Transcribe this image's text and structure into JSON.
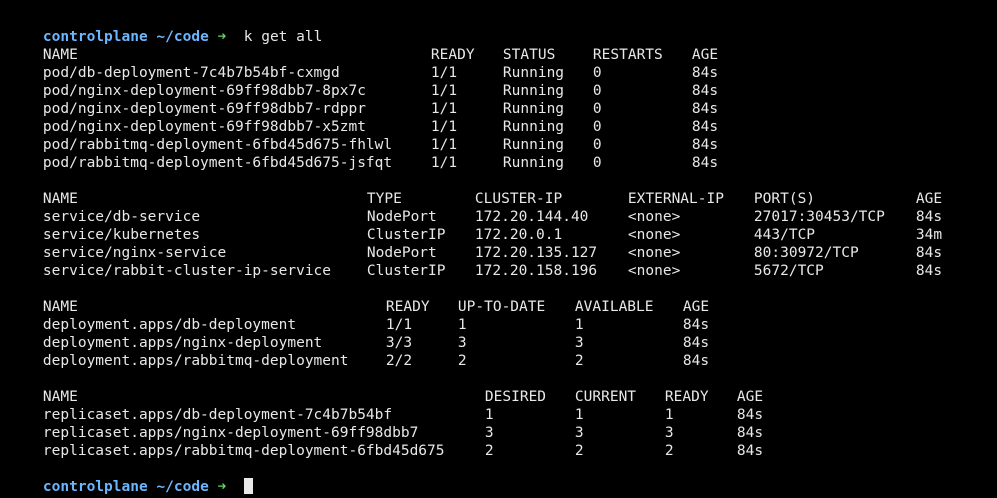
{
  "prompt": {
    "host": "controlplane",
    "cwd": "~/code",
    "arrow": "➜",
    "command": "k get all"
  },
  "pods": {
    "headers": [
      "NAME",
      "READY",
      "STATUS",
      "RESTARTS",
      "AGE"
    ],
    "rows": [
      [
        "pod/db-deployment-7c4b7b54bf-cxmgd",
        "1/1",
        "Running",
        "0",
        "84s"
      ],
      [
        "pod/nginx-deployment-69ff98dbb7-8px7c",
        "1/1",
        "Running",
        "0",
        "84s"
      ],
      [
        "pod/nginx-deployment-69ff98dbb7-rdppr",
        "1/1",
        "Running",
        "0",
        "84s"
      ],
      [
        "pod/nginx-deployment-69ff98dbb7-x5zmt",
        "1/1",
        "Running",
        "0",
        "84s"
      ],
      [
        "pod/rabbitmq-deployment-6fbd45d675-fhlwl",
        "1/1",
        "Running",
        "0",
        "84s"
      ],
      [
        "pod/rabbitmq-deployment-6fbd45d675-jsfqt",
        "1/1",
        "Running",
        "0",
        "84s"
      ]
    ]
  },
  "services": {
    "headers": [
      "NAME",
      "TYPE",
      "CLUSTER-IP",
      "EXTERNAL-IP",
      "PORT(S)",
      "AGE"
    ],
    "rows": [
      [
        "service/db-service",
        "NodePort",
        "172.20.144.40",
        "<none>",
        "27017:30453/TCP",
        "84s"
      ],
      [
        "service/kubernetes",
        "ClusterIP",
        "172.20.0.1",
        "<none>",
        "443/TCP",
        "34m"
      ],
      [
        "service/nginx-service",
        "NodePort",
        "172.20.135.127",
        "<none>",
        "80:30972/TCP",
        "84s"
      ],
      [
        "service/rabbit-cluster-ip-service",
        "ClusterIP",
        "172.20.158.196",
        "<none>",
        "5672/TCP",
        "84s"
      ]
    ]
  },
  "deployments": {
    "headers": [
      "NAME",
      "READY",
      "UP-TO-DATE",
      "AVAILABLE",
      "AGE"
    ],
    "rows": [
      [
        "deployment.apps/db-deployment",
        "1/1",
        "1",
        "1",
        "84s"
      ],
      [
        "deployment.apps/nginx-deployment",
        "3/3",
        "3",
        "3",
        "84s"
      ],
      [
        "deployment.apps/rabbitmq-deployment",
        "2/2",
        "2",
        "2",
        "84s"
      ]
    ]
  },
  "replicasets": {
    "headers": [
      "NAME",
      "DESIRED",
      "CURRENT",
      "READY",
      "AGE"
    ],
    "rows": [
      [
        "replicaset.apps/db-deployment-7c4b7b54bf",
        "1",
        "1",
        "1",
        "84s"
      ],
      [
        "replicaset.apps/nginx-deployment-69ff98dbb7",
        "3",
        "3",
        "3",
        "84s"
      ],
      [
        "replicaset.apps/rabbitmq-deployment-6fbd45d675",
        "2",
        "2",
        "2",
        "84s"
      ]
    ]
  },
  "colors": {
    "background": "#000000",
    "text": "#e8e8e8",
    "prompt": "#6cb6ff",
    "arrow": "#5fd75f"
  }
}
